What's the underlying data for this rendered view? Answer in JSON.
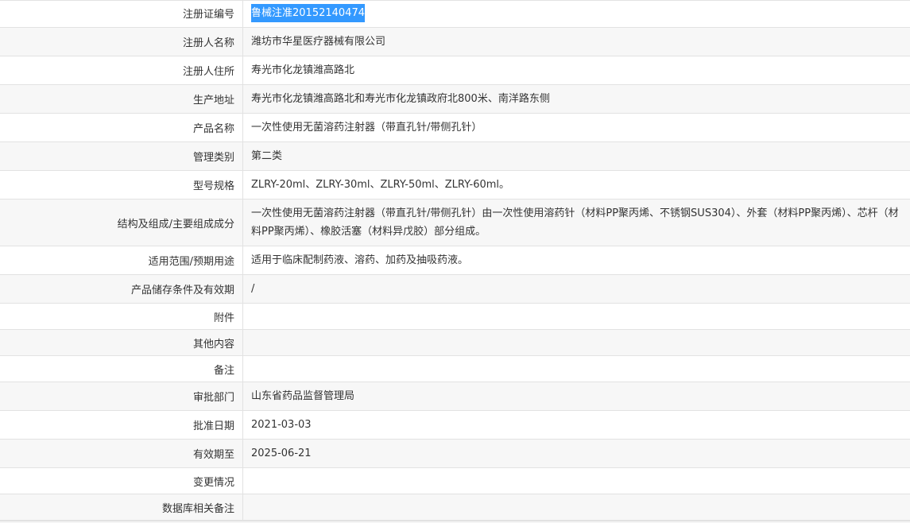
{
  "rows": [
    {
      "label": "注册证编号",
      "value": "鲁械注准20152140474"
    },
    {
      "label": "注册人名称",
      "value": "潍坊市华星医疗器械有限公司"
    },
    {
      "label": "注册人住所",
      "value": "寿光市化龙镇潍高路北"
    },
    {
      "label": "生产地址",
      "value": "寿光市化龙镇潍高路北和寿光市化龙镇政府北800米、南洋路东侧"
    },
    {
      "label": "产品名称",
      "value": "一次性使用无菌溶药注射器（带直孔针/带侧孔针）"
    },
    {
      "label": "管理类别",
      "value": "第二类"
    },
    {
      "label": "型号规格",
      "value": "ZLRY-20ml、ZLRY-30ml、ZLRY-50ml、ZLRY-60ml。"
    },
    {
      "label": "结构及组成/主要组成成分",
      "value": "一次性使用无菌溶药注射器（带直孔针/带侧孔针）由一次性使用溶药针（材料PP聚丙烯、不锈钢SUS304）、外套（材料PP聚丙烯）、芯杆（材料PP聚丙烯）、橡胶活塞（材料异戊胶）部分组成。"
    },
    {
      "label": "适用范围/预期用途",
      "value": "适用于临床配制药液、溶药、加药及抽吸药液。"
    },
    {
      "label": "产品储存条件及有效期",
      "value": "/"
    },
    {
      "label": "附件",
      "value": ""
    },
    {
      "label": "其他内容",
      "value": ""
    },
    {
      "label": "备注",
      "value": ""
    },
    {
      "label": "审批部门",
      "value": "山东省药品监督管理局"
    },
    {
      "label": "批准日期",
      "value": "2021-03-03"
    },
    {
      "label": "有效期至",
      "value": "2025-06-21"
    },
    {
      "label": "变更情况",
      "value": ""
    },
    {
      "label": "数据库相关备注",
      "value": ""
    }
  ]
}
